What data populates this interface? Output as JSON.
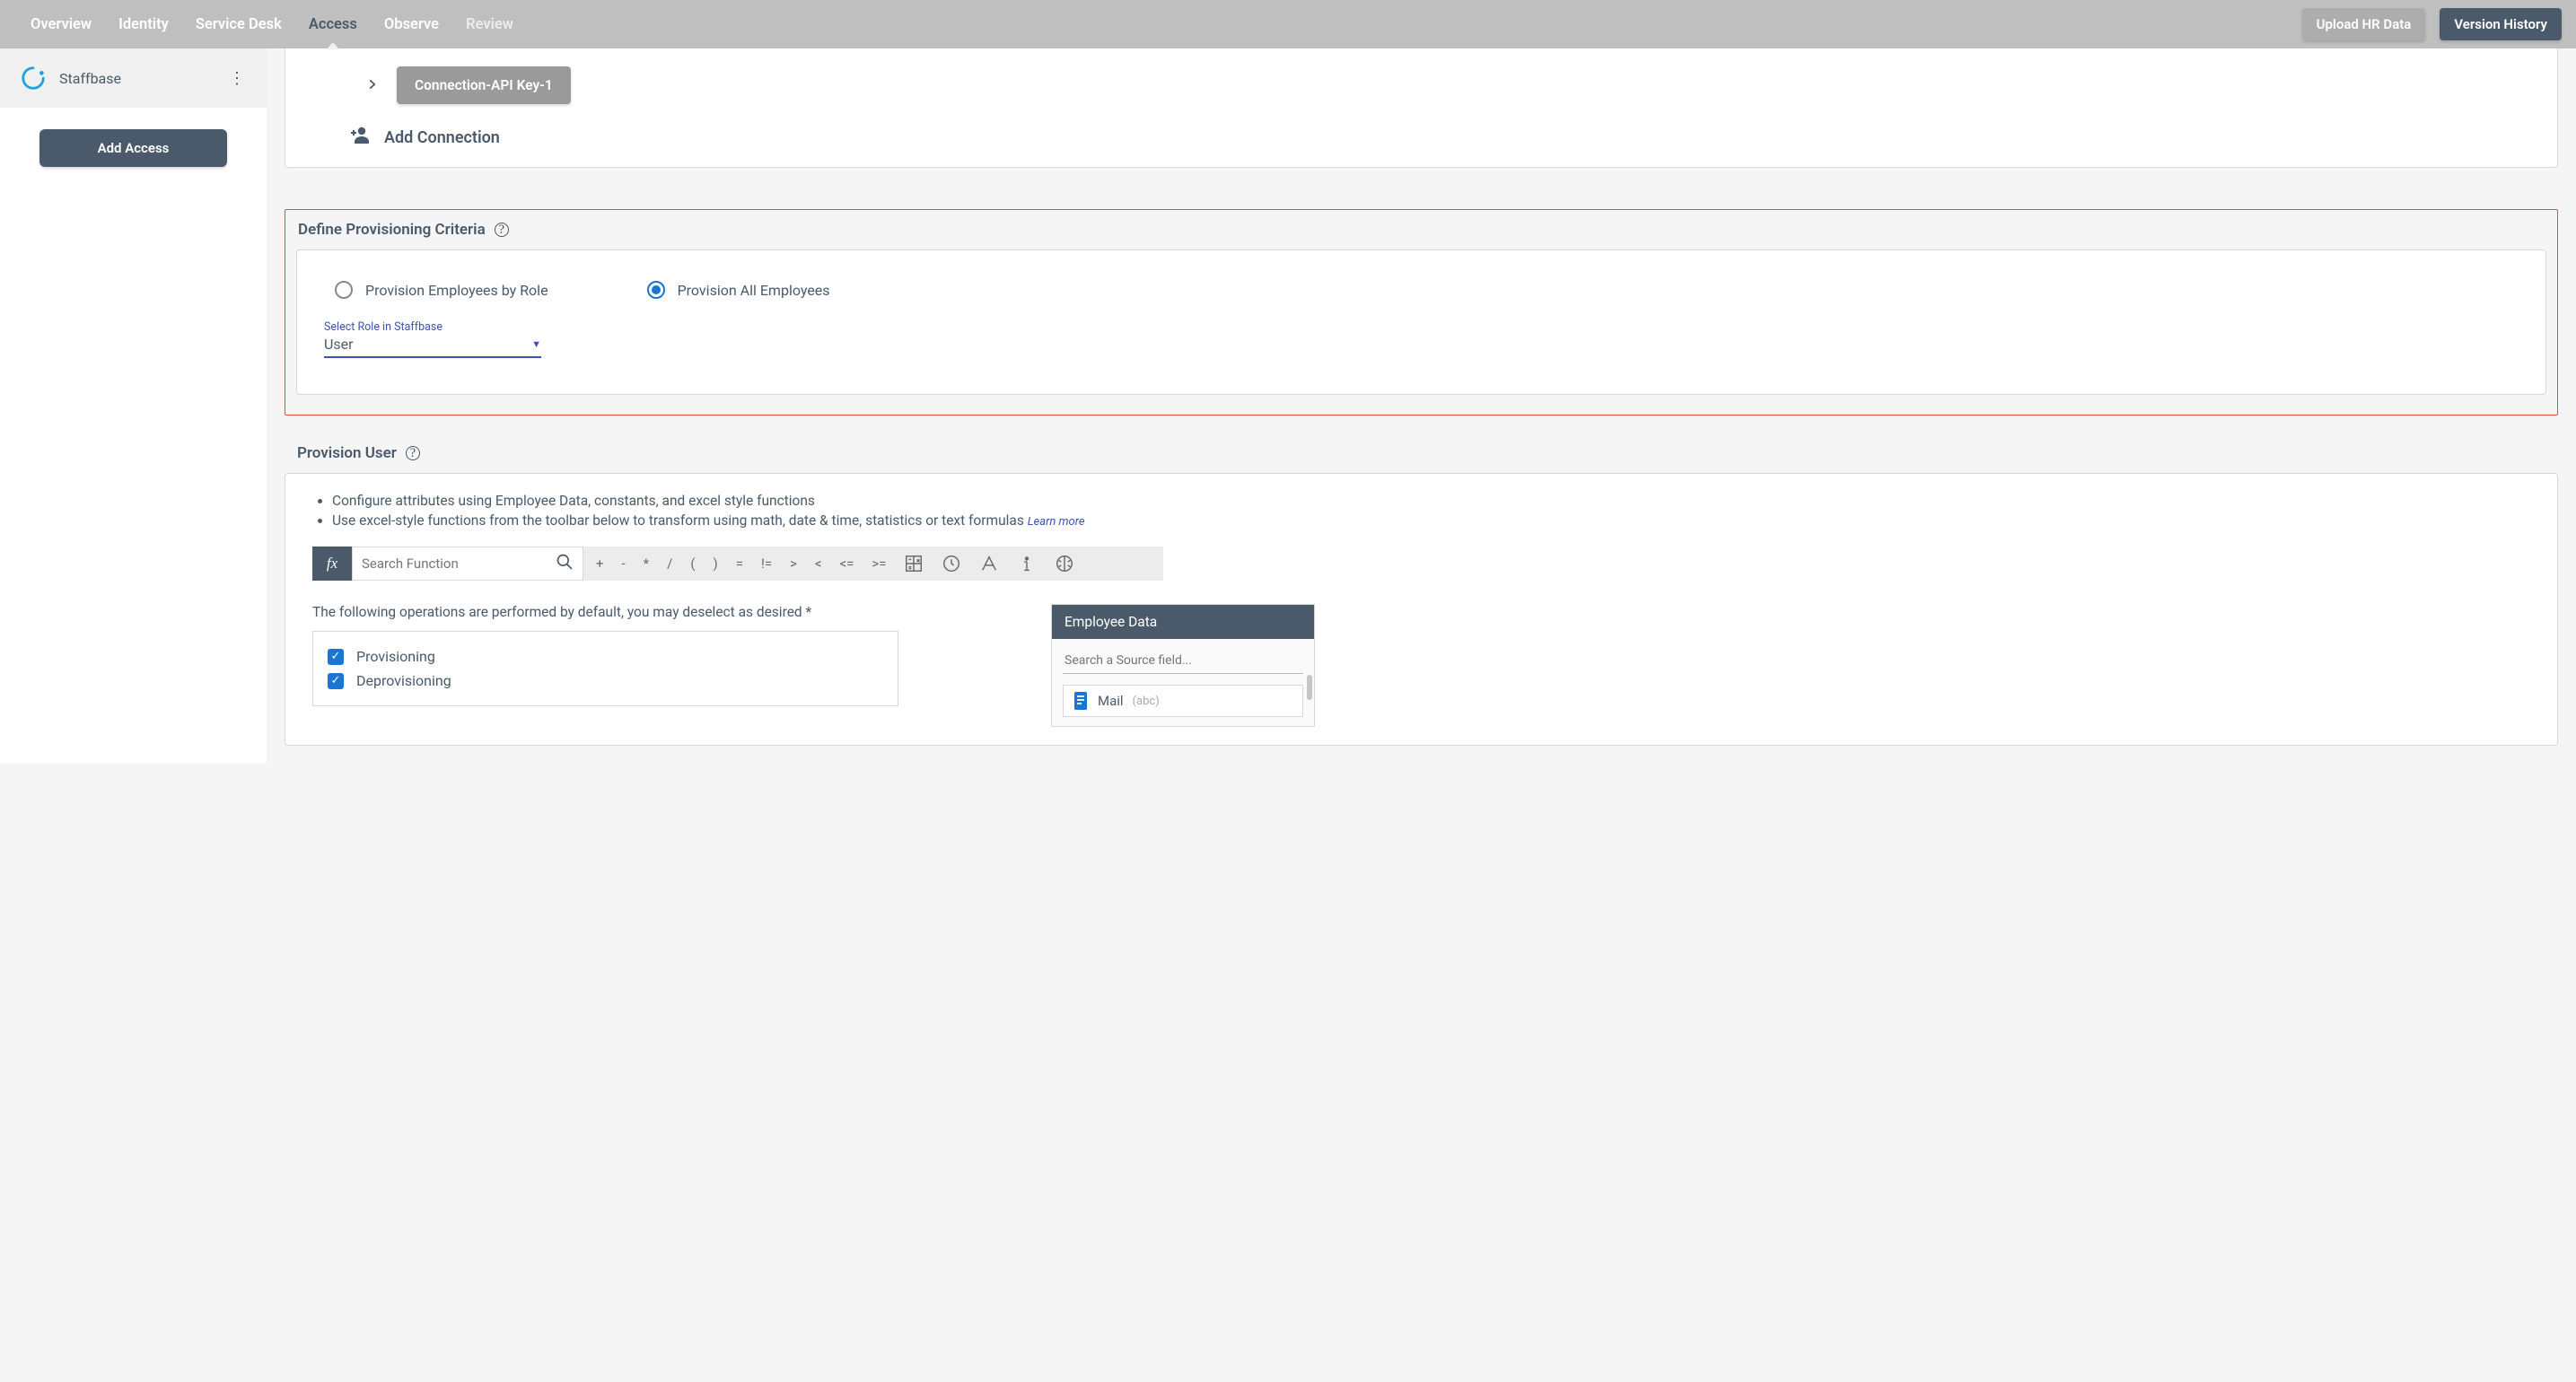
{
  "topnav": {
    "items": [
      "Overview",
      "Identity",
      "Service Desk",
      "Access",
      "Observe",
      "Review"
    ],
    "active_index": 3,
    "muted_index": 5,
    "btn_light": "Upload HR Data",
    "btn_dark": "Version History"
  },
  "sidebar": {
    "app_name": "Staffbase",
    "add_btn": "Add Access"
  },
  "connections": {
    "chip_label": "Connection-API Key-1",
    "add_label": "Add Connection"
  },
  "criteria": {
    "title": "Define Provisioning Criteria",
    "radio_by_role": "Provision Employees by Role",
    "radio_all": "Provision All Employees",
    "select_label": "Select Role in Staffbase",
    "select_value": "User"
  },
  "provision_user": {
    "title": "Provision User",
    "bullet1": "Configure attributes using Employee Data, constants, and excel style functions",
    "bullet2": "Use excel-style functions from the toolbar below to transform using math, date & time, statistics or text formulas",
    "learn_more": "Learn more",
    "search_placeholder": "Search Function",
    "operators": [
      "+",
      "-",
      "*",
      "/",
      "(",
      ")",
      "=",
      "!=",
      ">",
      "<",
      "<=",
      ">="
    ],
    "ops_text": "The following operations are performed by default, you may deselect as desired *",
    "ops": [
      {
        "label": "Provisioning",
        "checked": true
      },
      {
        "label": "Deprovisioning",
        "checked": true
      }
    ]
  },
  "employee_data": {
    "title": "Employee Data",
    "search_placeholder": "Search a Source field...",
    "fields": [
      {
        "name": "Mail",
        "type": "(abc)"
      }
    ]
  }
}
